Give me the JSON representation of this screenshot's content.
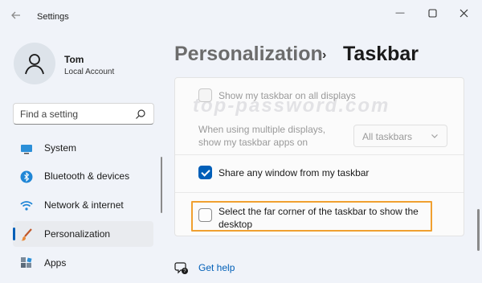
{
  "window": {
    "title": "Settings",
    "controls": {
      "minimize": "—",
      "maximize": "☐",
      "close": "✕"
    }
  },
  "user": {
    "name": "Tom",
    "account": "Local Account"
  },
  "search": {
    "placeholder": "Find a setting"
  },
  "sidebar": {
    "items": [
      {
        "label": "System",
        "icon": "system-icon",
        "selected": false
      },
      {
        "label": "Bluetooth & devices",
        "icon": "bluetooth-icon",
        "selected": false
      },
      {
        "label": "Network & internet",
        "icon": "wifi-icon",
        "selected": false
      },
      {
        "label": "Personalization",
        "icon": "brush-icon",
        "selected": true
      },
      {
        "label": "Apps",
        "icon": "apps-icon",
        "selected": false
      }
    ]
  },
  "header": {
    "parent": "Personalization",
    "separator": "›",
    "current": "Taskbar"
  },
  "watermark": "top-password.com",
  "options": {
    "show_all_displays": {
      "label": "Show my taskbar on all displays",
      "checked": false,
      "disabled": true
    },
    "multiple_displays": {
      "label_line1": "When using multiple displays,",
      "label_line2": "show my taskbar apps on",
      "value": "All taskbars",
      "disabled": true
    },
    "share_window": {
      "label": "Share any window from my taskbar",
      "checked": true
    },
    "far_corner": {
      "label_line1": "Select the far corner of the taskbar to show the",
      "label_line2": "desktop",
      "checked": false
    }
  },
  "help": {
    "label": "Get help"
  },
  "colors": {
    "accent": "#005fb8",
    "highlight": "#f0a030"
  }
}
